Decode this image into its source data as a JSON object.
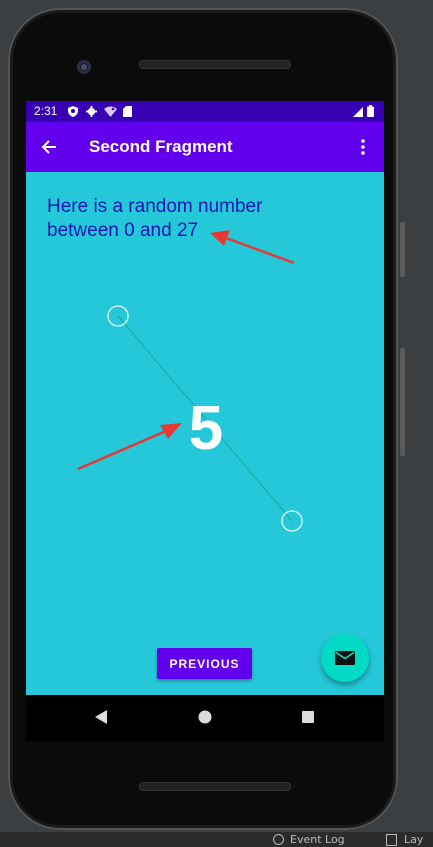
{
  "status_bar": {
    "time": "2:31"
  },
  "app_bar": {
    "title": "Second Fragment"
  },
  "content": {
    "message": "Here is a random number between 0 and 27",
    "random_number": "5",
    "previous_button": "PREVIOUS"
  },
  "ide": {
    "event_log": "Event Log",
    "layout_inspector": "Lay"
  },
  "colors": {
    "status_bar": "#3700b3",
    "app_bar": "#6200ee",
    "background": "#25c8d9",
    "fab": "#03dac5",
    "message_text": "#1818b0",
    "annotation_arrow": "#e53935"
  },
  "icons": [
    "back-arrow-icon",
    "overflow-menu-icon",
    "email-icon",
    "back-nav-icon",
    "home-nav-icon",
    "recents-nav-icon",
    "wifi-icon",
    "signal-icon",
    "battery-icon"
  ]
}
